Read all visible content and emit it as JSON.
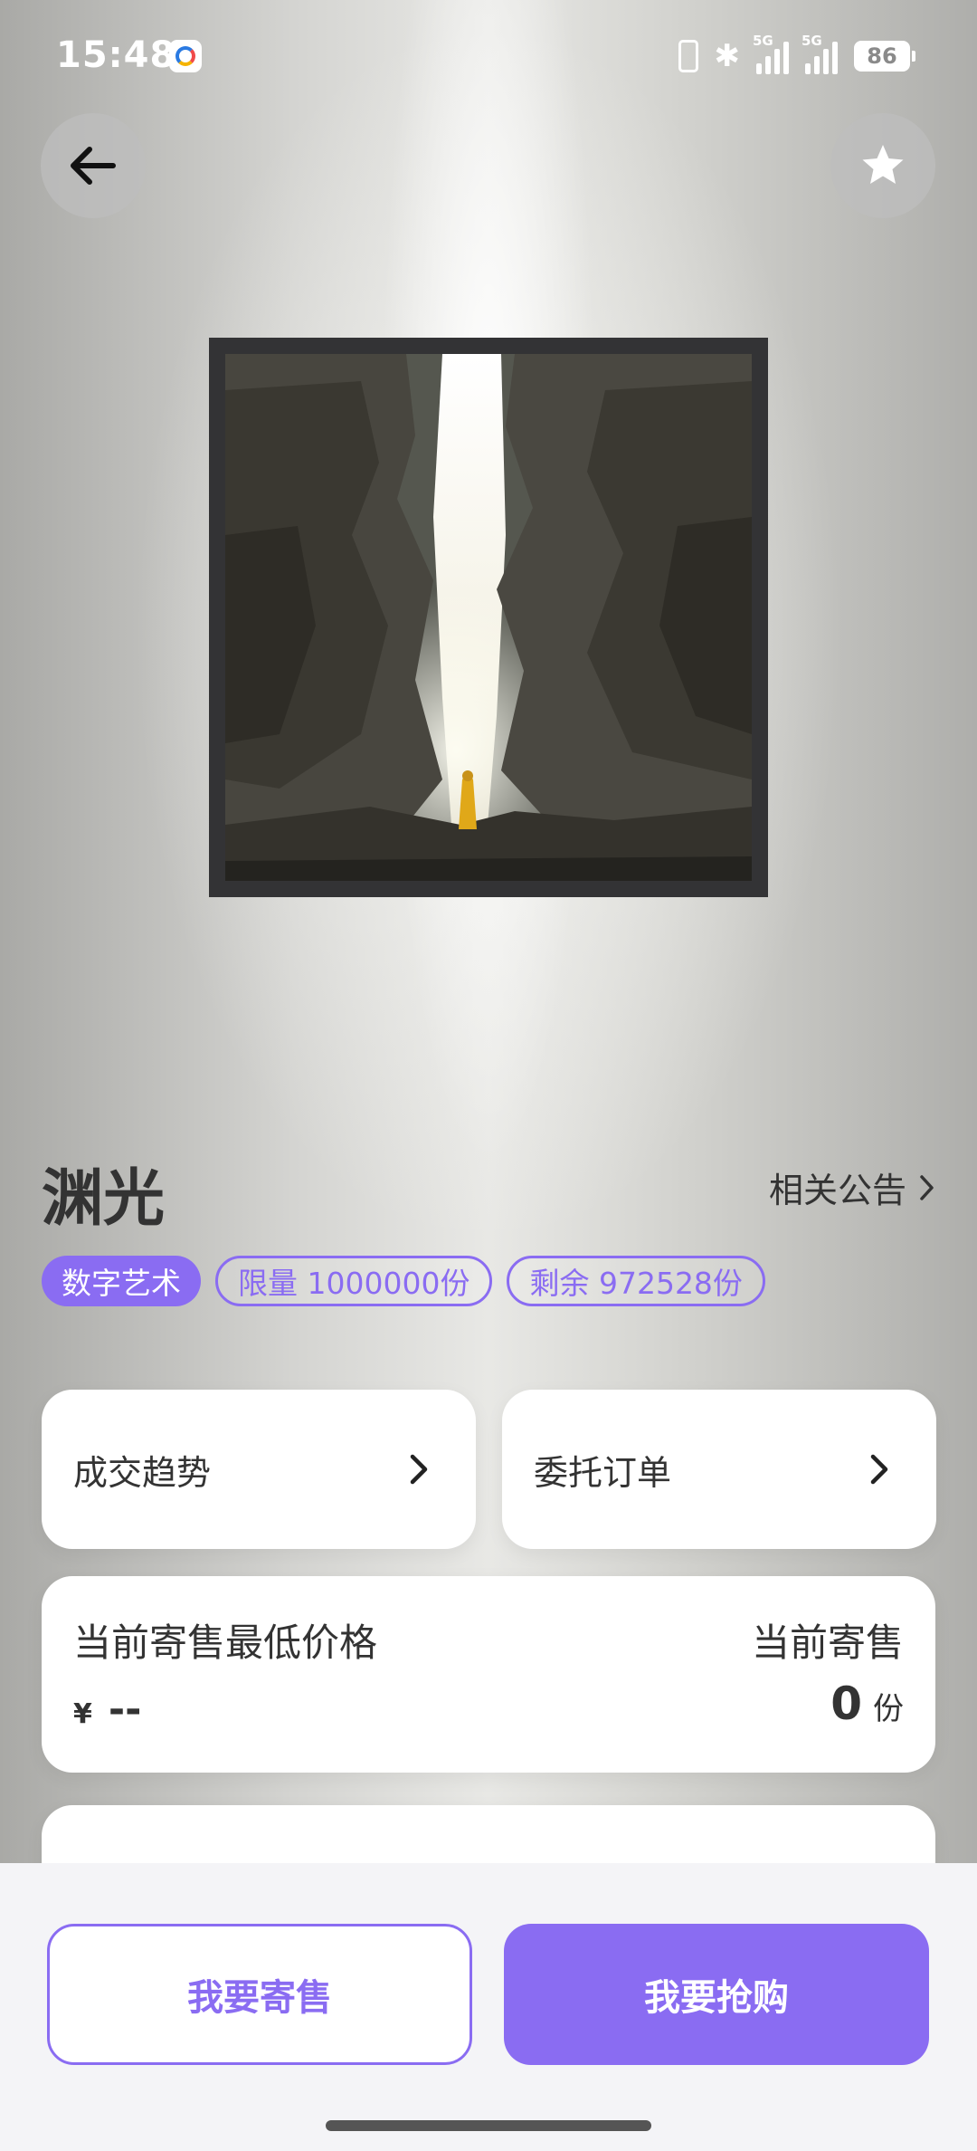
{
  "status_bar": {
    "time": "15:48",
    "signal1_label": "5G",
    "signal2_label": "5G",
    "battery": "86"
  },
  "header": {
    "back_icon": "arrow-left-icon",
    "favorite_icon": "star-icon"
  },
  "artwork": {
    "description_icon": "artwork-image"
  },
  "item": {
    "title": "渊光",
    "notice_label": "相关公告",
    "tags": [
      "数字艺术",
      "限量 1000000份",
      "剩余 972528份"
    ]
  },
  "cards": {
    "trend_label": "成交趋势",
    "orders_label": "委托订单"
  },
  "price_card": {
    "min_price_label": "当前寄售最低价格",
    "currency": "¥",
    "min_price_value": "--",
    "current_label": "当前寄售",
    "current_count": "0",
    "current_unit": "份"
  },
  "actions": {
    "sell_label": "我要寄售",
    "buy_label": "我要抢购"
  },
  "colors": {
    "accent": "#8a6cf2"
  }
}
